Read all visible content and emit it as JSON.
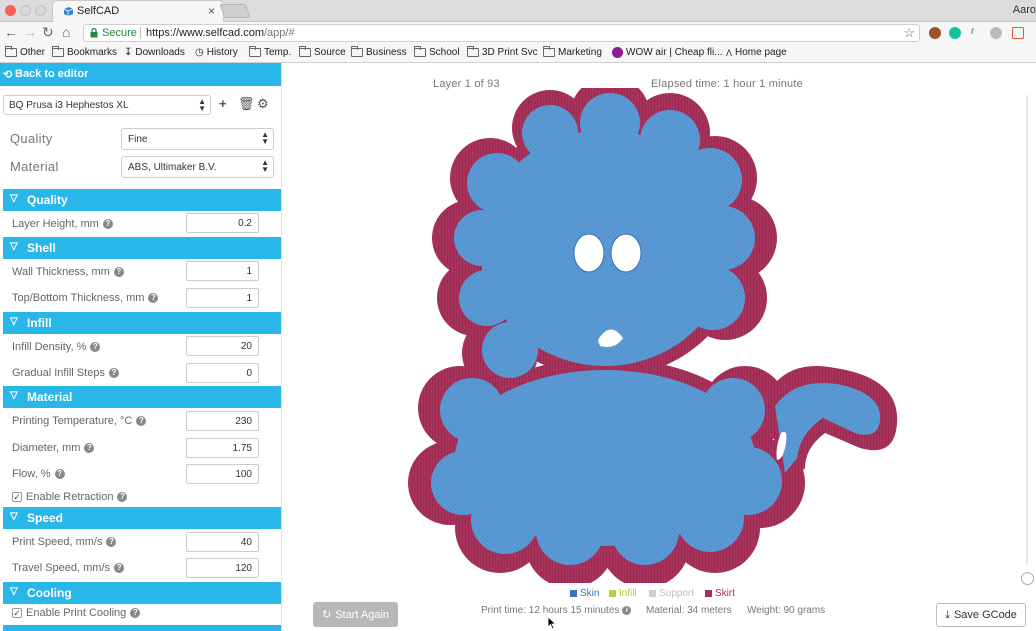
{
  "browser": {
    "tab_title": "SelfCAD",
    "tab_close": "×",
    "profile": "Aaro",
    "secure_label": "Secure",
    "url_domain": "https://www.selfcad.com",
    "url_path": "/app/#",
    "bookmarks": [
      "Other",
      "Bookmarks",
      "Downloads",
      "History",
      "Temp.",
      "Source",
      "Business",
      "School",
      "3D Print Svc",
      "Marketing",
      "WOW air | Cheap fli...",
      "Home page"
    ]
  },
  "panel": {
    "back_label": "Back to editor",
    "printer": "BQ Prusa i3 Hephestos XL",
    "quality_label": "Quality",
    "quality_value": "Fine",
    "material_label": "Material",
    "material_value": "ABS, Ultimaker B.V.",
    "sections": {
      "quality": "Quality",
      "shell": "Shell",
      "infill": "Infill",
      "material": "Material",
      "speed": "Speed",
      "cooling": "Cooling"
    },
    "fields": {
      "layer_height": {
        "label": "Layer Height, mm",
        "value": "0.2"
      },
      "wall_thickness": {
        "label": "Wall Thickness, mm",
        "value": "1"
      },
      "top_bottom": {
        "label": "Top/Bottom Thickness, mm",
        "value": "1"
      },
      "infill_density": {
        "label": "Infill Density, %",
        "value": "20"
      },
      "gradual_infill": {
        "label": "Gradual Infill Steps",
        "value": "0"
      },
      "print_temp": {
        "label": "Printing Temperature, °C",
        "value": "230"
      },
      "diameter": {
        "label": "Diameter, mm",
        "value": "1.75"
      },
      "flow": {
        "label": "Flow, %",
        "value": "100"
      },
      "print_speed": {
        "label": "Print Speed, mm/s",
        "value": "40"
      },
      "travel_speed": {
        "label": "Travel Speed, mm/s",
        "value": "120"
      }
    },
    "checks": {
      "retraction": {
        "label": "Enable Retraction",
        "checked": true
      },
      "cooling": {
        "label": "Enable Print Cooling",
        "checked": true
      }
    }
  },
  "viewer": {
    "layer_text": "Layer 1 of 93",
    "elapsed_text": "Elapsed time: 1 hour 1 minute",
    "legend": [
      {
        "label": "Skin",
        "color": "#3b73b9"
      },
      {
        "label": "Infill",
        "color": "#b4d334"
      },
      {
        "label": "Support",
        "color": "#cfcfcf"
      },
      {
        "label": "Skirt",
        "color": "#a8325c"
      }
    ],
    "print_time": "Print time: 12 hours 15 minutes",
    "material_used": "Material: 34 meters",
    "weight": "Weight: 90 grams",
    "start_again": "Start Again",
    "save_gcode": "Save GCode"
  },
  "colors": {
    "accent": "#29b6e8",
    "skin_fill": "#5b9bd5",
    "skirt": "#a8325c"
  }
}
